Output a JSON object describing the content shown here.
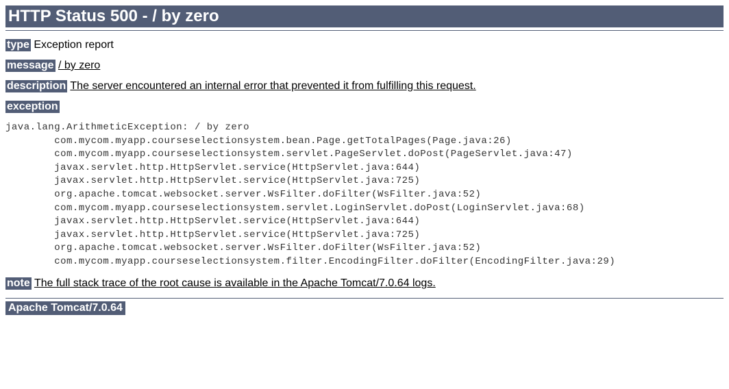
{
  "header": {
    "title": "HTTP Status 500 - / by zero"
  },
  "sections": {
    "type": {
      "label": "type",
      "value": "Exception report"
    },
    "message": {
      "label": "message",
      "value": "/ by zero"
    },
    "description": {
      "label": "description",
      "value": "The server encountered an internal error that prevented it from fulfilling this request."
    },
    "exception": {
      "label": "exception",
      "stacktrace": "java.lang.ArithmeticException: / by zero\n\tcom.mycom.myapp.courseselectionsystem.bean.Page.getTotalPages(Page.java:26)\n\tcom.mycom.myapp.courseselectionsystem.servlet.PageServlet.doPost(PageServlet.java:47)\n\tjavax.servlet.http.HttpServlet.service(HttpServlet.java:644)\n\tjavax.servlet.http.HttpServlet.service(HttpServlet.java:725)\n\torg.apache.tomcat.websocket.server.WsFilter.doFilter(WsFilter.java:52)\n\tcom.mycom.myapp.courseselectionsystem.servlet.LoginServlet.doPost(LoginServlet.java:68)\n\tjavax.servlet.http.HttpServlet.service(HttpServlet.java:644)\n\tjavax.servlet.http.HttpServlet.service(HttpServlet.java:725)\n\torg.apache.tomcat.websocket.server.WsFilter.doFilter(WsFilter.java:52)\n\tcom.mycom.myapp.courseselectionsystem.filter.EncodingFilter.doFilter(EncodingFilter.java:29)"
    },
    "note": {
      "label": "note",
      "value": "The full stack trace of the root cause is available in the Apache Tomcat/7.0.64 logs."
    }
  },
  "footer": {
    "server": "Apache Tomcat/7.0.64"
  }
}
